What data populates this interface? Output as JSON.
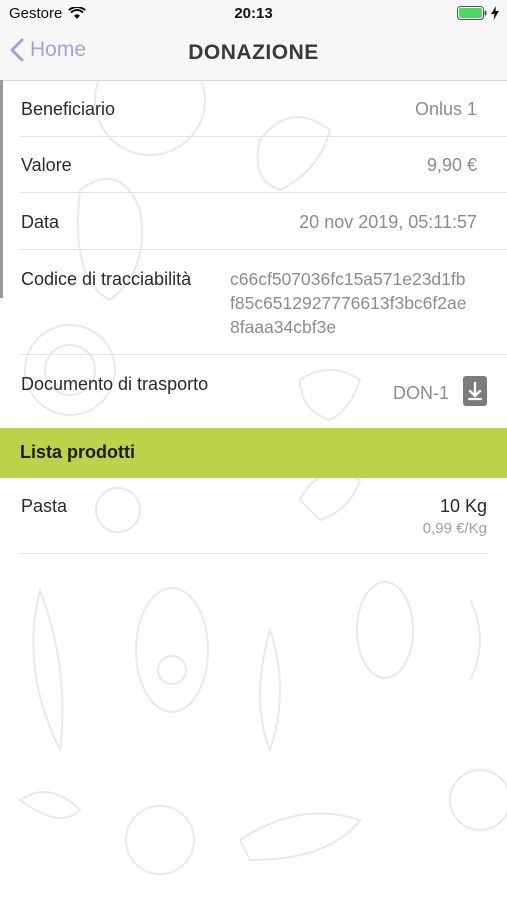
{
  "status_bar": {
    "carrier": "Gestore",
    "time": "20:13",
    "icons": [
      "wifi-icon",
      "battery-icon",
      "charging-bolt-icon"
    ],
    "battery_color": "#4cd964"
  },
  "nav": {
    "back_label": "Home",
    "title": "Donazione",
    "accent_color": "#a99ddb"
  },
  "details": {
    "beneficiario_label": "Beneficiario",
    "beneficiario_value": "Onlus 1",
    "valore_label": "Valore",
    "valore_value": "9,90 €",
    "data_label": "Data",
    "data_value": "20 nov 2019, 05:11:57",
    "codice_label": "Codice di tracciabilità",
    "codice_line1": "c66cf507036fc15a571e23d1fb",
    "codice_line2": "f85c6512927776613f3bc6f2ae",
    "codice_line3": "8faaa34cbf3e",
    "documento_label": "Documento di trasporto",
    "documento_value": "DON-1",
    "documento_icon": "download-icon"
  },
  "products": {
    "section_title": "Lista prodotti",
    "section_color": "#bcd24a",
    "items": [
      {
        "name": "Pasta",
        "quantity": "10 Kg",
        "unit_price": "0,99 €/Kg"
      }
    ]
  }
}
